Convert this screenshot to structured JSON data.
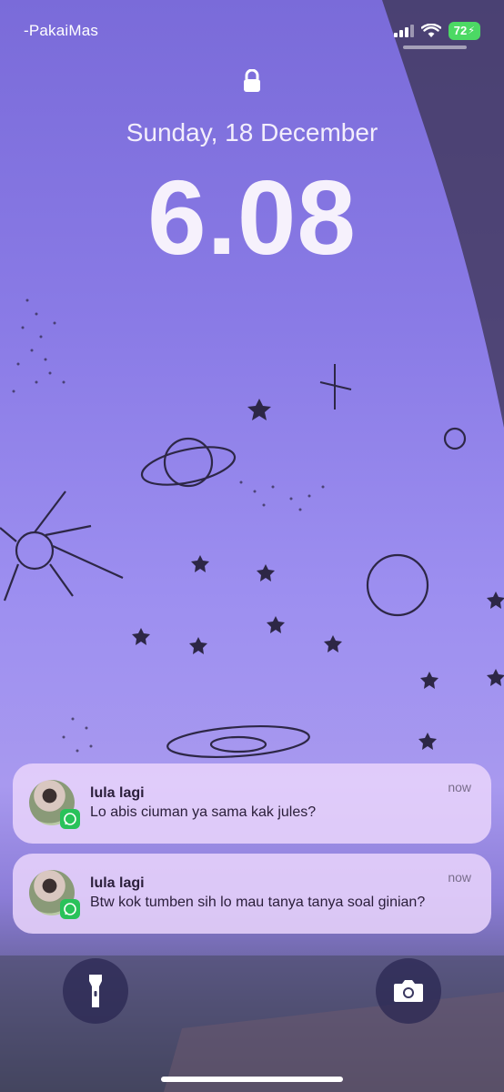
{
  "status_bar": {
    "carrier": "-PakaiMas",
    "battery": "72"
  },
  "lock_screen": {
    "date": "Sunday, 18 December",
    "time": "6.08"
  },
  "notifications": [
    {
      "app": "WhatsApp",
      "sender": "lula lagi",
      "message": "Lo abis ciuman ya sama kak jules?",
      "time": "now"
    },
    {
      "app": "WhatsApp",
      "sender": "lula lagi",
      "message": "Btw kok tumben sih lo mau tanya tanya soal ginian?",
      "time": "now"
    }
  ],
  "buttons": {
    "left": "flashlight-icon",
    "right": "camera-icon"
  },
  "colors": {
    "accent": "#8a7be6",
    "notification_bg": "#e9d4fc",
    "whatsapp": "#29c25a",
    "battery": "#4cd964"
  }
}
